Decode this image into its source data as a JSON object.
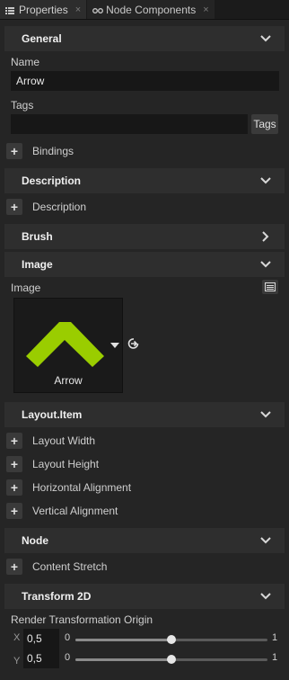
{
  "tabs": [
    {
      "label": "Properties",
      "close": "×"
    },
    {
      "label": "Node Components",
      "close": "×"
    }
  ],
  "sections": {
    "general": {
      "title": "General"
    },
    "description": {
      "title": "Description"
    },
    "brush": {
      "title": "Brush"
    },
    "image": {
      "title": "Image"
    },
    "layout_item": {
      "title": "Layout.Item"
    },
    "node": {
      "title": "Node"
    },
    "transform": {
      "title": "Transform 2D"
    }
  },
  "general": {
    "name_label": "Name",
    "name_value": "Arrow",
    "tags_label": "Tags",
    "tags_value": "",
    "tags_button": "Tags",
    "bindings_label": "Bindings"
  },
  "description": {
    "add_label": "Description"
  },
  "image": {
    "field_label": "Image",
    "asset_name": "Arrow",
    "accent_color": "#9acd00"
  },
  "layout_item": {
    "properties": [
      "Layout Width",
      "Layout Height",
      "Horizontal Alignment",
      "Vertical Alignment"
    ]
  },
  "node": {
    "add_label": "Content Stretch"
  },
  "transform": {
    "origin_label": "Render Transformation Origin",
    "x": {
      "axis": "X",
      "value": "0,5",
      "min": "0",
      "max": "1",
      "fraction": 0.5
    },
    "y": {
      "axis": "Y",
      "value": "0,5",
      "min": "0",
      "max": "1",
      "fraction": 0.5
    }
  }
}
